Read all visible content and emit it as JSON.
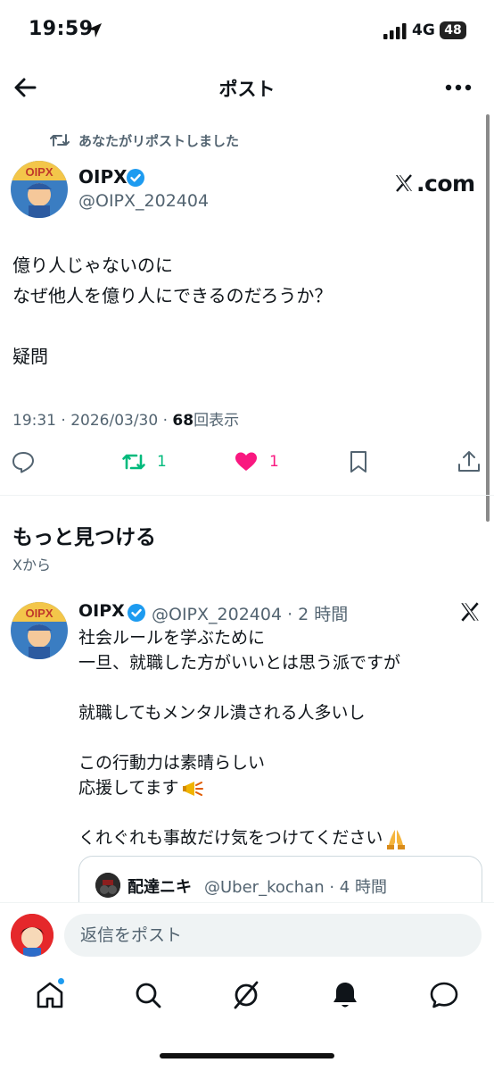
{
  "status_bar": {
    "time": "19:59",
    "network": "4G",
    "battery": "48"
  },
  "header": {
    "title": "ポスト"
  },
  "post": {
    "repost_notice": "あなたがリポストしました",
    "author_name": "OIPX",
    "author_handle": "@OIPX_202404",
    "source_badge": "com",
    "body_lines": [
      "億り人じゃないのに",
      "なぜ他人を億り人にできるのだろうか？",
      "",
      "疑問"
    ],
    "timestamp": "19:31 · 2026/03/30 · ",
    "views_count": "68",
    "views_label": "回表示",
    "retweet_count": "1",
    "like_count": "1"
  },
  "discover": {
    "title": "もっと見つける",
    "subtitle": "Xから"
  },
  "feed_item": {
    "author_name": "OIPX",
    "handle_time": "@OIPX_202404 · 2 時間",
    "body_lines": [
      "社会ルールを学ぶために",
      "一旦、就職した方がいいとは思う派ですが",
      "",
      "就職してもメンタル潰される人多いし",
      "",
      "この行動力は素晴らしい",
      "応援してます",
      "",
      "くれぐれも事故だけ気をつけてください"
    ],
    "quote": {
      "author_name": "配達ニキ",
      "handle_time": "@Uber_kochan · 4 時間"
    }
  },
  "reply": {
    "placeholder": "返信をポスト"
  },
  "tabs": [
    "home-icon",
    "search-icon",
    "grok-icon",
    "notifications-icon",
    "messages-icon"
  ],
  "colors": {
    "accent": "#1d9bf0",
    "retweet": "#00ba7c",
    "like": "#f91880",
    "secondary_text": "#536471"
  }
}
